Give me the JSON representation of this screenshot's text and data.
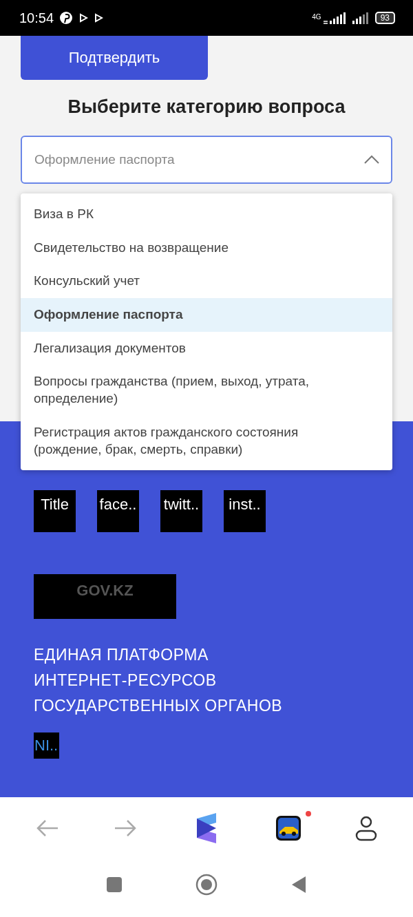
{
  "status_bar": {
    "time": "10:54",
    "network": "4G",
    "battery": "93"
  },
  "confirm_button": {
    "label": "Подтвердить"
  },
  "category": {
    "heading": "Выберите категорию вопроса",
    "placeholder": "Оформление паспорта",
    "expanded": true,
    "options": [
      {
        "label": "Виза в РК",
        "selected": false
      },
      {
        "label": "Свидетельство на возвращение",
        "selected": false
      },
      {
        "label": "Консульский учет",
        "selected": false
      },
      {
        "label": "Оформление паспорта",
        "selected": true
      },
      {
        "label": "Легализация документов",
        "selected": false
      },
      {
        "label": "Вопросы гражданства (прием, выход, утрата, определение)",
        "selected": false
      },
      {
        "label": "Регистрация актов гражданского состояния (рождение, брак, смерть, справки)",
        "selected": false
      }
    ]
  },
  "footer": {
    "social_links": [
      "Title",
      "face..",
      "twitt..",
      "inst.."
    ],
    "logo_text": "GOV.KZ",
    "platform_title": "ЕДИНАЯ ПЛАТФОРМА\nИНТЕРНЕТ-РЕСУРСОВ\nГОСУДАРСТВЕННЫХ ОРГАНОВ",
    "language": "NI.."
  },
  "browser_bar": {
    "notification": true
  }
}
